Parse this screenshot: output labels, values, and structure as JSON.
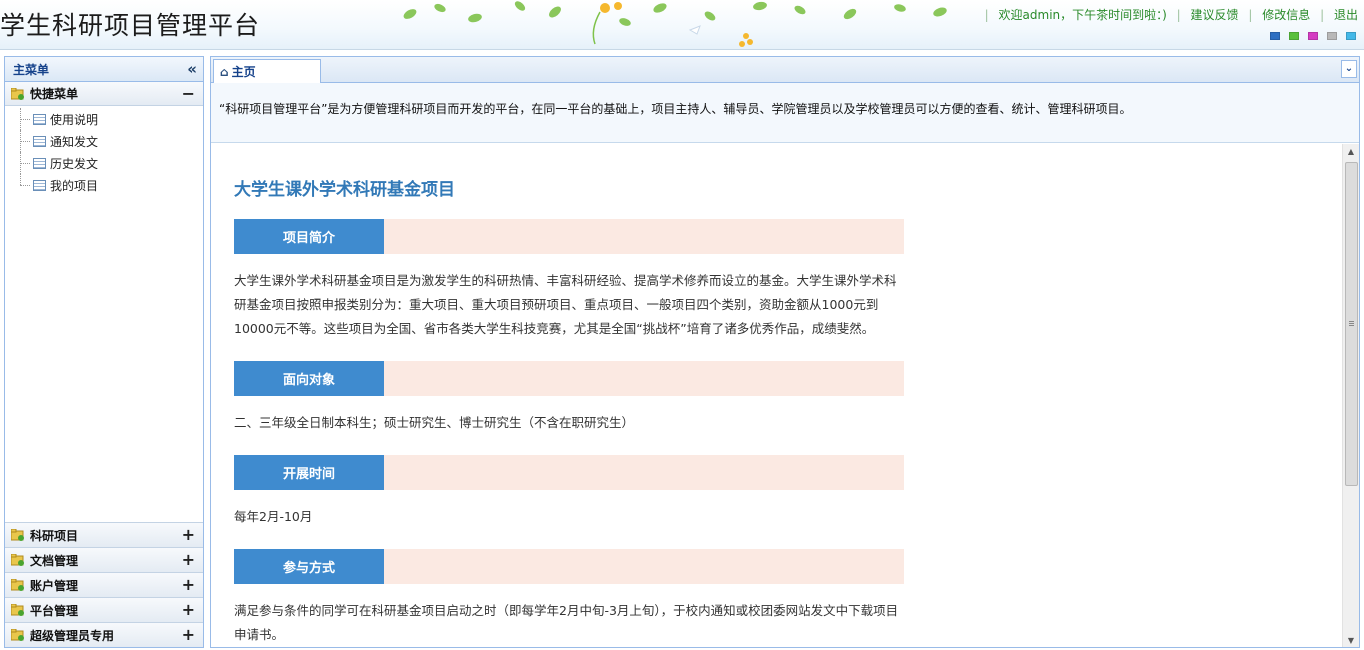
{
  "header": {
    "site_title": "学生科研项目管理平台",
    "welcome": "欢迎admin，下午茶时间到啦：)",
    "links": {
      "feedback": "建议反馈",
      "edit_info": "修改信息",
      "logout": "退出"
    },
    "skin_colors": [
      "#2d6fc2",
      "#59c03c",
      "#d43cc2",
      "#b8b8b8",
      "#43b8e8"
    ]
  },
  "sidebar": {
    "title": "主菜单",
    "quick_menu": {
      "label": "快捷菜单",
      "toggle": "−",
      "items": [
        {
          "label": "使用说明"
        },
        {
          "label": "通知发文"
        },
        {
          "label": "历史发文"
        },
        {
          "label": "我的项目"
        }
      ]
    },
    "sections": [
      {
        "label": "科研项目",
        "toggle": "+"
      },
      {
        "label": "文档管理",
        "toggle": "+"
      },
      {
        "label": "账户管理",
        "toggle": "+"
      },
      {
        "label": "平台管理",
        "toggle": "+"
      },
      {
        "label": "超级管理员专用",
        "toggle": "+"
      }
    ]
  },
  "main": {
    "tab_label": "主页",
    "intro": "“科研项目管理平台”是为方便管理科研项目而开发的平台，在同一平台的基础上，项目主持人、辅导员、学院管理员以及学校管理员可以方便的查看、统计、管理科研项目。",
    "article": {
      "title": "大学生课外学术科研基金项目",
      "sections": [
        {
          "heading": "项目简介",
          "body": "大学生课外学术科研基金项目是为激发学生的科研热情、丰富科研经验、提高学术修养而设立的基金。大学生课外学术科研基金项目按照申报类别分为：重大项目、重大项目预研项目、重点项目、一般项目四个类别，资助金额从1000元到10000元不等。这些项目为全国、省市各类大学生科技竞赛，尤其是全国“挑战杯”培育了诸多优秀作品，成绩斐然。"
        },
        {
          "heading": "面向对象",
          "body": "二、三年级全日制本科生；硕士研究生、博士研究生（不含在职研究生）"
        },
        {
          "heading": "开展时间",
          "body": "每年2月-10月"
        },
        {
          "heading": "参与方式",
          "body": "满足参与条件的同学可在科研基金项目启动之时（即每学年2月中旬-3月上旬），于校内通知或校团委网站发文中下载项目申请书。"
        }
      ]
    }
  }
}
